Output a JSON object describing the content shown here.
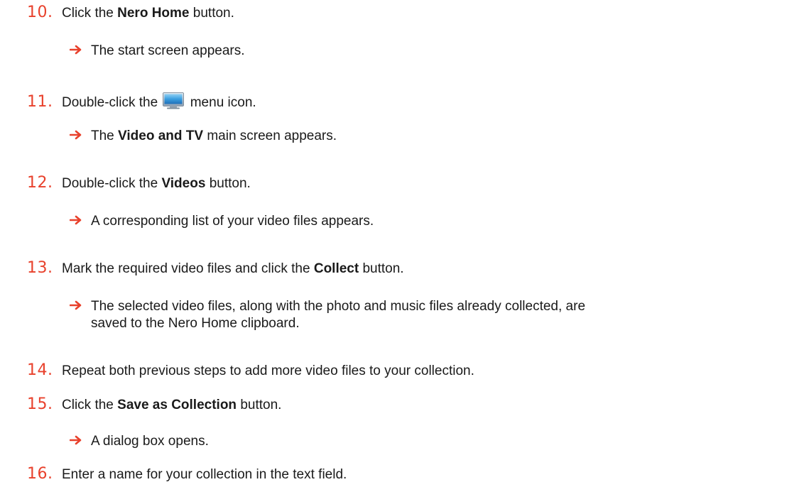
{
  "steps": [
    {
      "num": "10.",
      "pre": "Click the ",
      "bold": "Nero Home",
      "post": " button."
    },
    {
      "num": "11.",
      "pre": "Double-click the ",
      "icon": "tv-monitor-icon",
      "post": " menu icon."
    },
    {
      "num": "12.",
      "pre": "Double-click the ",
      "bold": "Videos",
      "post": " button."
    },
    {
      "num": "13.",
      "pre": "Mark the required video files and click the ",
      "bold": "Collect",
      "post": " button."
    },
    {
      "num": "14.",
      "pre": "Repeat both previous steps to add more video files to your collection."
    },
    {
      "num": "15.",
      "pre": "Click the ",
      "bold": "Save as Collection",
      "post": " button."
    },
    {
      "num": "16.",
      "pre": "Enter a name for your collection in the text field."
    }
  ],
  "results": [
    {
      "text": "The start screen appears."
    },
    {
      "pre": "The ",
      "bold": "Video and TV",
      "post": " main screen appears."
    },
    {
      "text": "A corresponding list of your video files appears."
    },
    {
      "line1": "The selected video files, along with the photo and music files already collected, are",
      "line2": "saved to the Nero Home clipboard."
    },
    {
      "text": "A dialog box opens."
    }
  ],
  "colors": {
    "step_number": "#e8412c",
    "arrow": "#e8412c",
    "text": "#1a1a1a"
  },
  "icons": {
    "result_marker": "right-arrow-icon",
    "inline_menu_icon": "tv-monitor-icon"
  }
}
